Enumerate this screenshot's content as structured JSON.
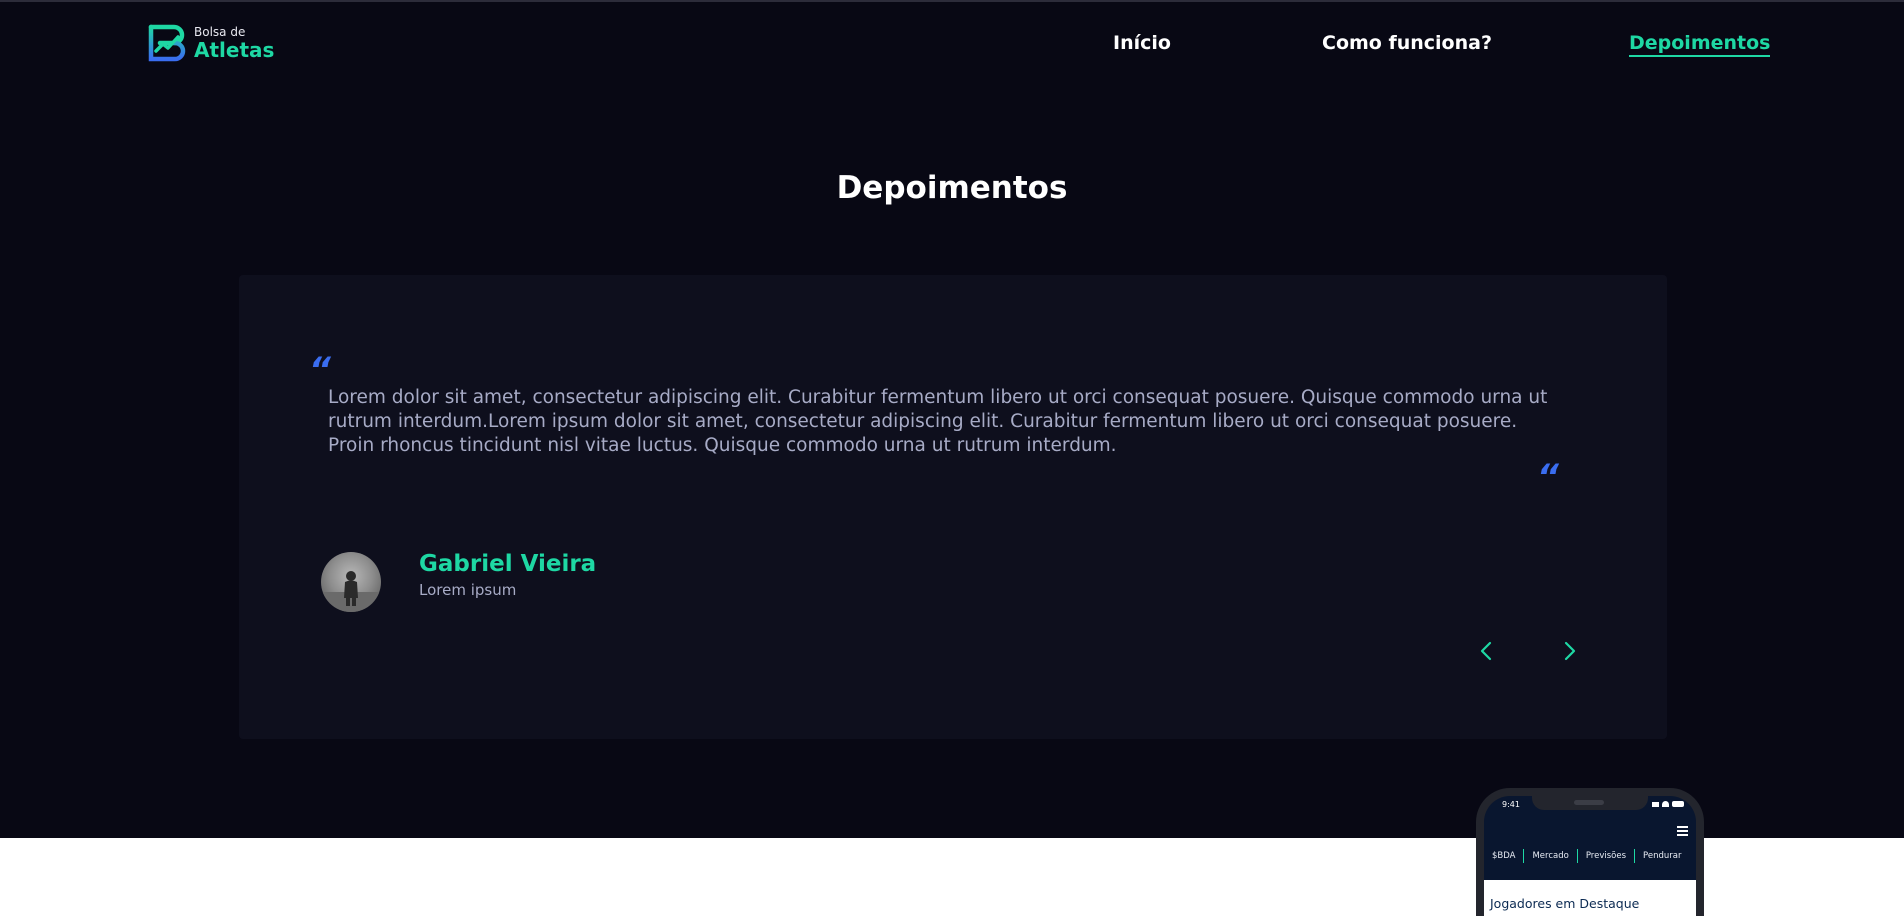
{
  "header": {
    "logo": {
      "line1": "Bolsa de",
      "line2": "Atletas",
      "accent": "#1ed8a4",
      "accent2": "#3a6df0"
    },
    "nav": [
      {
        "label": "Início",
        "active": false
      },
      {
        "label": "Como funciona?",
        "active": false
      },
      {
        "label": "Depoimentos",
        "active": true
      }
    ]
  },
  "section": {
    "title": "Depoimentos"
  },
  "testimonial": {
    "quote_open": "“",
    "quote_close": "“",
    "text": "Lorem dolor sit amet, consectetur adipiscing elit. Curabitur fermentum libero ut orci consequat posuere. Quisque commodo urna ut rutrum interdum.Lorem ipsum dolor sit amet, consectetur adipiscing elit. Curabitur fermentum libero ut orci consequat posuere. Proin rhoncus tincidunt nisl vitae luctus. Quisque commodo urna ut rutrum interdum.",
    "author": {
      "name": "Gabriel Vieira",
      "role": "Lorem ipsum"
    },
    "controls": {
      "prev_icon": "chevron-left-icon",
      "next_icon": "chevron-right-icon"
    }
  },
  "phone": {
    "time": "9:41",
    "tabs": [
      "$BDA",
      "Mercado",
      "Previsões",
      "Pendurar"
    ],
    "featured_title": "Jogadores em Destaque"
  },
  "colors": {
    "background": "#080814",
    "card": "#0e0f1d",
    "accent": "#1ed8a4",
    "quote": "#3a6df0",
    "body_text": "#a7abc6"
  }
}
